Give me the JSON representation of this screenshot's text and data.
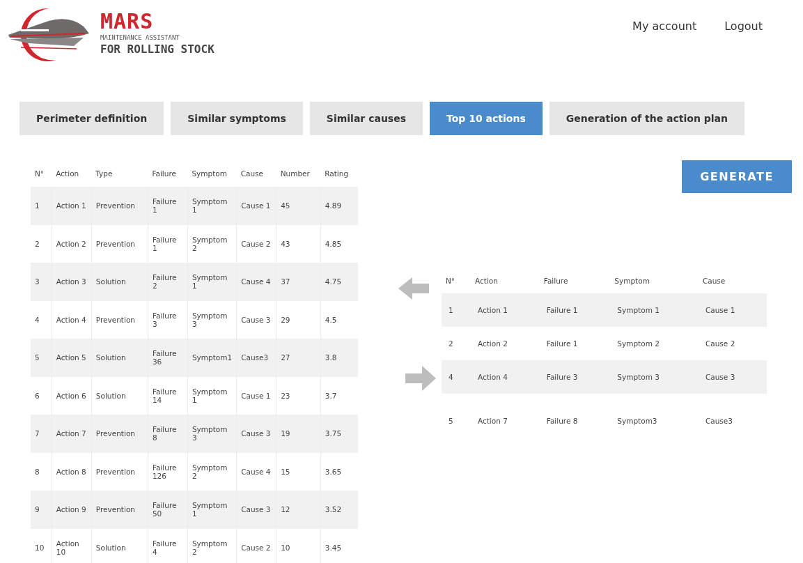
{
  "logo": {
    "title": "MARS",
    "subtitle": "MAINTENANCE ASSISTANT",
    "tagline": "FOR ROLLING STOCK"
  },
  "nav": [
    "My account",
    "Logout"
  ],
  "tabs": [
    {
      "label": "Perimeter definition",
      "selected": false
    },
    {
      "label": "Similar symptoms",
      "selected": false
    },
    {
      "label": "Similar causes",
      "selected": false
    },
    {
      "label": "Top 10 actions",
      "selected": true
    },
    {
      "label": "Generation of the action plan",
      "selected": false
    }
  ],
  "actions_table": {
    "columns": [
      "N°",
      "Action",
      "Type",
      "Failure",
      "Symptom",
      "Cause",
      "Number",
      "Rating"
    ],
    "rows": [
      [
        "1",
        "Action 1",
        "Prevention",
        "Failure 1",
        "Symptom 1",
        "Cause 1",
        "45",
        "4.89"
      ],
      [
        "2",
        "Action 2",
        "Prevention",
        "Failure 1",
        "Symptom 2",
        "Cause 2",
        "43",
        "4.85"
      ],
      [
        "3",
        "Action 3",
        "Solution",
        "Failure 2",
        "Symptom 1",
        "Cause 4",
        "37",
        "4.75"
      ],
      [
        "4",
        "Action 4",
        "Prevention",
        "Failure 3",
        "Symptom 3",
        "Cause 3",
        "29",
        "4.5"
      ],
      [
        "5",
        "Action 5",
        "Solution",
        "Failure 36",
        "Symptom1",
        "Cause3",
        "27",
        "3.8"
      ],
      [
        "6",
        "Action 6",
        "Solution",
        "Failure 14",
        "Symptom 1",
        "Cause 1",
        "23",
        "3.7"
      ],
      [
        "7",
        "Action 7",
        "Prevention",
        "Failure 8",
        "Symptom 3",
        "Cause 3",
        "19",
        "3.75"
      ],
      [
        "8",
        "Action 8",
        "Prevention",
        "Failure 126",
        "Symptom 2",
        "Cause 4",
        "15",
        "3.65"
      ],
      [
        "9",
        "Action 9",
        "Prevention",
        "Failure 50",
        "Symptom 1",
        "Cause 3",
        "12",
        "3.52"
      ],
      [
        "10",
        "Action 10",
        "Solution",
        "Failure 4",
        "Symptom 2",
        "Cause 2",
        "10",
        "3.45"
      ]
    ]
  },
  "generate_button": "GENERATE",
  "plan_table": {
    "columns": [
      "N°",
      "Action",
      "Failure",
      "Symptom",
      "Cause"
    ],
    "rows": [
      [
        "1",
        "Action 1",
        "Failure 1",
        "Symptom 1",
        "Cause 1"
      ],
      [
        "2",
        "Action 2",
        "Failure 1",
        "Symptom 2",
        "Cause 2"
      ],
      [
        "4",
        "Action 4",
        "Failure 3",
        "Symptom 3",
        "Cause 3"
      ],
      [
        "5",
        "Action 7",
        "Failure 8",
        "Symptom3",
        "Cause3"
      ]
    ]
  }
}
